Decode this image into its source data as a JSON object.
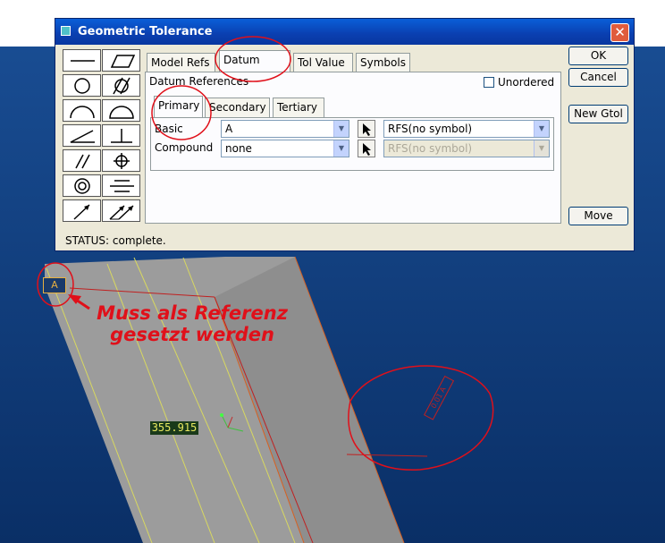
{
  "dialog": {
    "title": "Geometric Tolerance",
    "close_glyph": "✕",
    "buttons": {
      "ok": "OK",
      "cancel": "Cancel",
      "new_gtol": "New Gtol",
      "move": "Move"
    },
    "tabs": [
      "Model Refs",
      "Datum Refs",
      "Tol Value",
      "Symbols"
    ],
    "active_tab": "Datum Refs",
    "datum_references_label": "Datum References",
    "unordered_label": "Unordered",
    "unordered_checked": false,
    "subtabs": [
      "Primary",
      "Secondary",
      "Tertiary"
    ],
    "active_subtab": "Primary",
    "rows": [
      {
        "label": "Basic",
        "datum": "A",
        "modifier": "RFS(no symbol)",
        "modifier_enabled": true
      },
      {
        "label": "Compound",
        "datum": "none",
        "modifier": "RFS(no symbol)",
        "modifier_enabled": false
      }
    ],
    "status": "STATUS: complete.",
    "symbols": [
      "straightness-icon",
      "flatness-icon",
      "circularity-icon",
      "cylindricity-icon",
      "line-profile-icon",
      "surface-profile-icon",
      "angularity-icon",
      "perpendicularity-icon",
      "parallelism-icon",
      "position-icon",
      "concentricity-icon",
      "symmetry-icon",
      "circular-runout-icon",
      "total-runout-icon"
    ]
  },
  "viewport": {
    "datum_tag": "A",
    "dimension_value": "355.915",
    "annotation_text": "Muss als Referenz gesetzt werden",
    "annotation_line1": "Muss als Referenz",
    "annotation_line2": "gesetzt werden",
    "gtol_frame_text": "0.01 A",
    "colors": {
      "background": "#0a3a78",
      "part": "#9a9a9a",
      "annotation": "#e0101a",
      "edge": "#e8e840"
    }
  }
}
